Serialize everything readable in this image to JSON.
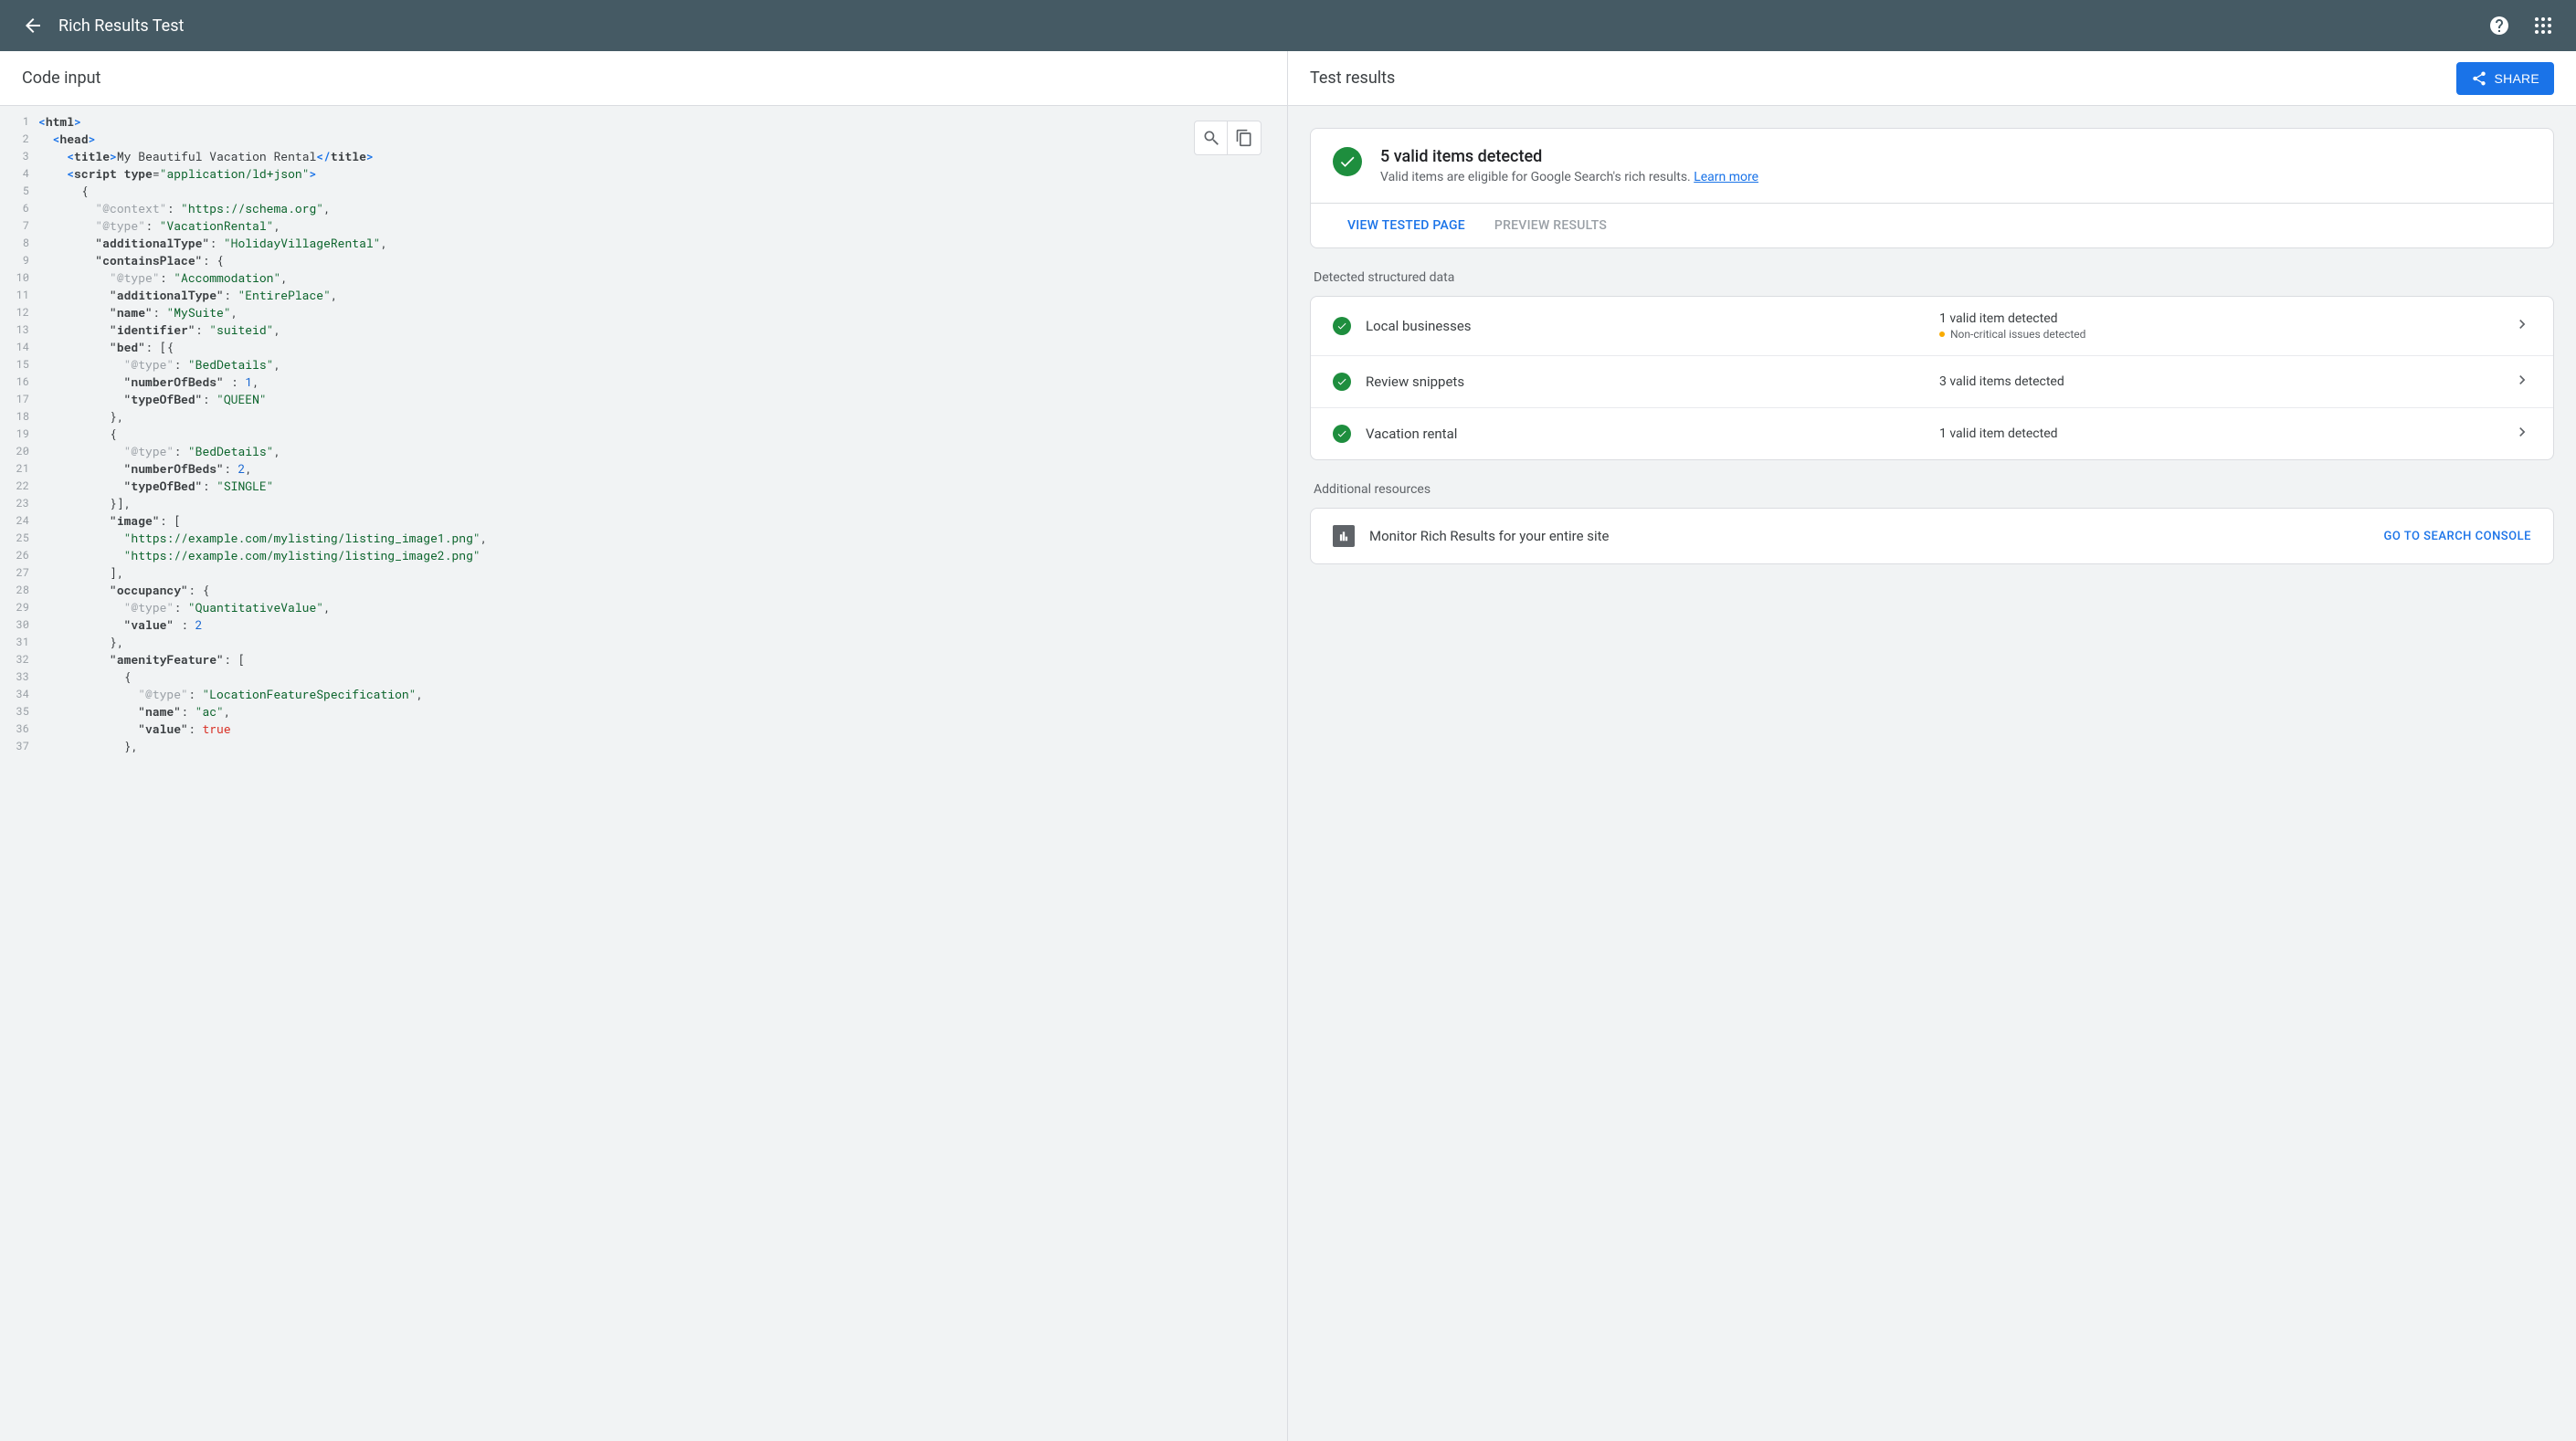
{
  "appbar": {
    "title": "Rich Results Test"
  },
  "left": {
    "header": "Code input"
  },
  "share": {
    "label": "SHARE"
  },
  "right": {
    "header": "Test results",
    "summary": {
      "title": "5 valid items detected",
      "subtitle": "Valid items are eligible for Google Search's rich results. ",
      "learn_more": "Learn more"
    },
    "tabs": {
      "view": "VIEW TESTED PAGE",
      "preview": "PREVIEW RESULTS"
    },
    "detected_label": "Detected structured data",
    "detected": [
      {
        "name": "Local businesses",
        "status": "1 valid item detected",
        "sub": "Non-critical issues detected",
        "warn": true
      },
      {
        "name": "Review snippets",
        "status": "3 valid items detected",
        "sub": "",
        "warn": false
      },
      {
        "name": "Vacation rental",
        "status": "1 valid item detected",
        "sub": "",
        "warn": false
      }
    ],
    "additional_label": "Additional resources",
    "resource": {
      "text": "Monitor Rich Results for your entire site",
      "action": "GO TO SEARCH CONSOLE"
    }
  },
  "code": [
    {
      "n": 1,
      "tokens": [
        [
          "tag",
          "<"
        ],
        [
          "tag-name",
          "html"
        ],
        [
          "tag",
          ">"
        ]
      ]
    },
    {
      "n": 2,
      "tokens": [
        [
          "text",
          "  "
        ],
        [
          "tag",
          "<"
        ],
        [
          "tag-name",
          "head"
        ],
        [
          "tag",
          ">"
        ]
      ]
    },
    {
      "n": 3,
      "tokens": [
        [
          "text",
          "    "
        ],
        [
          "tag",
          "<"
        ],
        [
          "tag-name",
          "title"
        ],
        [
          "tag",
          ">"
        ],
        [
          "text",
          "My Beautiful Vacation Rental"
        ],
        [
          "tag",
          "</"
        ],
        [
          "tag-name",
          "title"
        ],
        [
          "tag",
          ">"
        ]
      ]
    },
    {
      "n": 4,
      "tokens": [
        [
          "text",
          "    "
        ],
        [
          "tag",
          "<"
        ],
        [
          "tag-name",
          "script"
        ],
        [
          "text",
          " "
        ],
        [
          "attr",
          "type"
        ],
        [
          "punc",
          "="
        ],
        [
          "str",
          "\"application/ld+json\""
        ],
        [
          "tag",
          ">"
        ]
      ]
    },
    {
      "n": 5,
      "tokens": [
        [
          "text",
          "      "
        ],
        [
          "punc",
          "{"
        ]
      ]
    },
    {
      "n": 6,
      "tokens": [
        [
          "text",
          "        "
        ],
        [
          "key-muted",
          "\"@context\""
        ],
        [
          "punc",
          ": "
        ],
        [
          "str",
          "\"https://schema.org\""
        ],
        [
          "punc",
          ","
        ]
      ]
    },
    {
      "n": 7,
      "tokens": [
        [
          "text",
          "        "
        ],
        [
          "key-muted",
          "\"@type\""
        ],
        [
          "punc",
          ": "
        ],
        [
          "str",
          "\"VacationRental\""
        ],
        [
          "punc",
          ","
        ]
      ]
    },
    {
      "n": 8,
      "tokens": [
        [
          "text",
          "        "
        ],
        [
          "key-bold",
          "\"additionalType\""
        ],
        [
          "punc",
          ": "
        ],
        [
          "str",
          "\"HolidayVillageRental\""
        ],
        [
          "punc",
          ","
        ]
      ]
    },
    {
      "n": 9,
      "tokens": [
        [
          "text",
          "        "
        ],
        [
          "key-bold",
          "\"containsPlace\""
        ],
        [
          "punc",
          ": {"
        ]
      ]
    },
    {
      "n": 10,
      "tokens": [
        [
          "text",
          "          "
        ],
        [
          "key-muted",
          "\"@type\""
        ],
        [
          "punc",
          ": "
        ],
        [
          "str",
          "\"Accommodation\""
        ],
        [
          "punc",
          ","
        ]
      ]
    },
    {
      "n": 11,
      "tokens": [
        [
          "text",
          "          "
        ],
        [
          "key-bold",
          "\"additionalType\""
        ],
        [
          "punc",
          ": "
        ],
        [
          "str",
          "\"EntirePlace\""
        ],
        [
          "punc",
          ","
        ]
      ]
    },
    {
      "n": 12,
      "tokens": [
        [
          "text",
          "          "
        ],
        [
          "key-bold",
          "\"name\""
        ],
        [
          "punc",
          ": "
        ],
        [
          "str",
          "\"MySuite\""
        ],
        [
          "punc",
          ","
        ]
      ]
    },
    {
      "n": 13,
      "tokens": [
        [
          "text",
          "          "
        ],
        [
          "key-bold",
          "\"identifier\""
        ],
        [
          "punc",
          ": "
        ],
        [
          "str",
          "\"suiteid\""
        ],
        [
          "punc",
          ","
        ]
      ]
    },
    {
      "n": 14,
      "tokens": [
        [
          "text",
          "          "
        ],
        [
          "key-bold",
          "\"bed\""
        ],
        [
          "punc",
          ": [{"
        ]
      ]
    },
    {
      "n": 15,
      "tokens": [
        [
          "text",
          "            "
        ],
        [
          "key-muted",
          "\"@type\""
        ],
        [
          "punc",
          ": "
        ],
        [
          "str",
          "\"BedDetails\""
        ],
        [
          "punc",
          ","
        ]
      ]
    },
    {
      "n": 16,
      "tokens": [
        [
          "text",
          "            "
        ],
        [
          "key-bold",
          "\"numberOfBeds\""
        ],
        [
          "punc",
          " : "
        ],
        [
          "num",
          "1"
        ],
        [
          "punc",
          ","
        ]
      ]
    },
    {
      "n": 17,
      "tokens": [
        [
          "text",
          "            "
        ],
        [
          "key-bold",
          "\"typeOfBed\""
        ],
        [
          "punc",
          ": "
        ],
        [
          "str",
          "\"QUEEN\""
        ]
      ]
    },
    {
      "n": 18,
      "tokens": [
        [
          "text",
          "          "
        ],
        [
          "punc",
          "},"
        ]
      ]
    },
    {
      "n": 19,
      "tokens": [
        [
          "text",
          "          "
        ],
        [
          "punc",
          "{"
        ]
      ]
    },
    {
      "n": 20,
      "tokens": [
        [
          "text",
          "            "
        ],
        [
          "key-muted",
          "\"@type\""
        ],
        [
          "punc",
          ": "
        ],
        [
          "str",
          "\"BedDetails\""
        ],
        [
          "punc",
          ","
        ]
      ]
    },
    {
      "n": 21,
      "tokens": [
        [
          "text",
          "            "
        ],
        [
          "key-bold",
          "\"numberOfBeds\""
        ],
        [
          "punc",
          ": "
        ],
        [
          "num",
          "2"
        ],
        [
          "punc",
          ","
        ]
      ]
    },
    {
      "n": 22,
      "tokens": [
        [
          "text",
          "            "
        ],
        [
          "key-bold",
          "\"typeOfBed\""
        ],
        [
          "punc",
          ": "
        ],
        [
          "str",
          "\"SINGLE\""
        ]
      ]
    },
    {
      "n": 23,
      "tokens": [
        [
          "text",
          "          "
        ],
        [
          "punc",
          "}],"
        ]
      ]
    },
    {
      "n": 24,
      "tokens": [
        [
          "text",
          "          "
        ],
        [
          "key-bold",
          "\"image\""
        ],
        [
          "punc",
          ": ["
        ]
      ]
    },
    {
      "n": 25,
      "tokens": [
        [
          "text",
          "            "
        ],
        [
          "str",
          "\"https://example.com/mylisting/listing_image1.png\""
        ],
        [
          "punc",
          ","
        ]
      ]
    },
    {
      "n": 26,
      "tokens": [
        [
          "text",
          "            "
        ],
        [
          "str",
          "\"https://example.com/mylisting/listing_image2.png\""
        ]
      ]
    },
    {
      "n": 27,
      "tokens": [
        [
          "text",
          "          "
        ],
        [
          "punc",
          "],"
        ]
      ]
    },
    {
      "n": 28,
      "tokens": [
        [
          "text",
          "          "
        ],
        [
          "key-bold",
          "\"occupancy\""
        ],
        [
          "punc",
          ": {"
        ]
      ]
    },
    {
      "n": 29,
      "tokens": [
        [
          "text",
          "            "
        ],
        [
          "key-muted",
          "\"@type\""
        ],
        [
          "punc",
          ": "
        ],
        [
          "str",
          "\"QuantitativeValue\""
        ],
        [
          "punc",
          ","
        ]
      ]
    },
    {
      "n": 30,
      "tokens": [
        [
          "text",
          "            "
        ],
        [
          "key-bold",
          "\"value\""
        ],
        [
          "punc",
          " : "
        ],
        [
          "num",
          "2"
        ]
      ]
    },
    {
      "n": 31,
      "tokens": [
        [
          "text",
          "          "
        ],
        [
          "punc",
          "},"
        ]
      ]
    },
    {
      "n": 32,
      "tokens": [
        [
          "text",
          "          "
        ],
        [
          "key-bold",
          "\"amenityFeature\""
        ],
        [
          "punc",
          ": ["
        ]
      ]
    },
    {
      "n": 33,
      "tokens": [
        [
          "text",
          "            "
        ],
        [
          "punc",
          "{"
        ]
      ]
    },
    {
      "n": 34,
      "tokens": [
        [
          "text",
          "              "
        ],
        [
          "key-muted",
          "\"@type\""
        ],
        [
          "punc",
          ": "
        ],
        [
          "str",
          "\"LocationFeatureSpecification\""
        ],
        [
          "punc",
          ","
        ]
      ]
    },
    {
      "n": 35,
      "tokens": [
        [
          "text",
          "              "
        ],
        [
          "key-bold",
          "\"name\""
        ],
        [
          "punc",
          ": "
        ],
        [
          "str",
          "\"ac\""
        ],
        [
          "punc",
          ","
        ]
      ]
    },
    {
      "n": 36,
      "tokens": [
        [
          "text",
          "              "
        ],
        [
          "key-bold",
          "\"value\""
        ],
        [
          "punc",
          ": "
        ],
        [
          "bool",
          "true"
        ]
      ]
    },
    {
      "n": 37,
      "tokens": [
        [
          "text",
          "            "
        ],
        [
          "punc",
          "},"
        ]
      ]
    }
  ]
}
